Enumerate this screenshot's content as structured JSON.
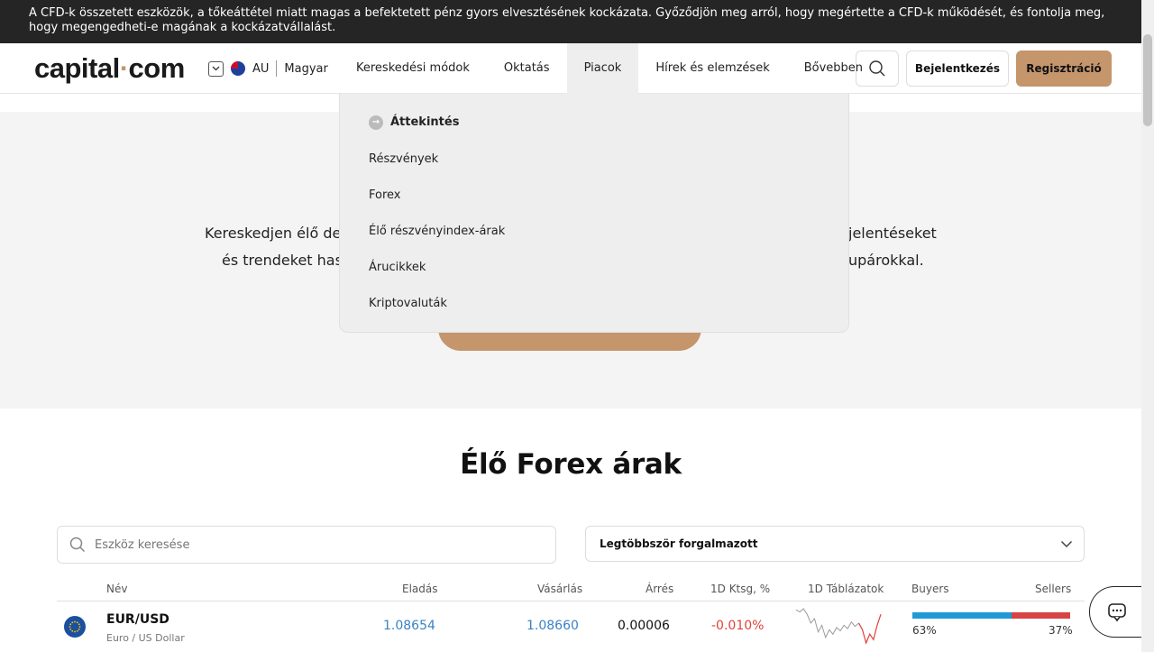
{
  "risk_warning": {
    "line1": "A CFD-k összetett eszközök, a tőkeáttétel miatt magas a befektetett pénz gyors elvesztésének kockázata. Győződjön meg arról, hogy megértette a CFD-k működését, és fontolja meg,",
    "line2": "hogy megengedheti-e magának a kockázatvállalást."
  },
  "header": {
    "logo_left": "capital",
    "logo_dot": "·",
    "logo_right": "com",
    "region": "AU",
    "language": "Magyar",
    "nav": [
      "Kereskedési módok",
      "Oktatás",
      "Piacok",
      "Hírek és elemzések",
      "Bővebben"
    ],
    "active_nav": "Piacok",
    "login_label": "Bejelentkezés",
    "register_label": "Regisztráció"
  },
  "markets_menu": {
    "overview": "Áttekintés",
    "items": [
      "Részvények",
      "Forex",
      "Élő részvényindex-árak",
      "Árucikkek",
      "Kriptovaluták"
    ]
  },
  "hero": {
    "line1_left": "Kereskedjen élő de",
    "line1_right": "jelentéseket",
    "line2_left": "és trendeket has",
    "line2_right": "upárokkal."
  },
  "forex": {
    "title": "Élő Forex árak",
    "search_placeholder": "Eszköz keresése",
    "sort_value": "Legtöbbször forgalmazott",
    "columns": {
      "name": "Név",
      "sell": "Eladás",
      "buy": "Vásárlás",
      "spread": "Árrés",
      "change": "1D Ktsg, %",
      "chart": "1D Táblázatok",
      "buyers": "Buyers",
      "sellers": "Sellers"
    },
    "rows": [
      {
        "symbol": "EUR/USD",
        "description": "Euro / US Dollar",
        "sell": "1.08654",
        "buy": "1.08660",
        "spread": "0.00006",
        "change": "-0.010%",
        "buyers_pct": "63%",
        "sellers_pct": "37%",
        "buyers_fraction": 0.63,
        "sparkline": [
          1.088,
          1.0878,
          1.0881,
          1.0876,
          1.0868,
          1.0872,
          1.086,
          1.0866,
          1.0855,
          1.0862,
          1.0858,
          1.0864,
          1.0861,
          1.0866,
          1.0863,
          1.0869,
          1.0865,
          1.0868,
          1.0862,
          1.085,
          1.0858,
          1.0853,
          1.0866,
          1.0876
        ]
      }
    ]
  },
  "colors": {
    "accent": "#c5956c",
    "price_blue": "#3a82c4",
    "negative_red": "#e0423a",
    "buyers_blue": "#1f9ad6",
    "sellers_red": "#d64444",
    "dark_bar": "#252525"
  }
}
